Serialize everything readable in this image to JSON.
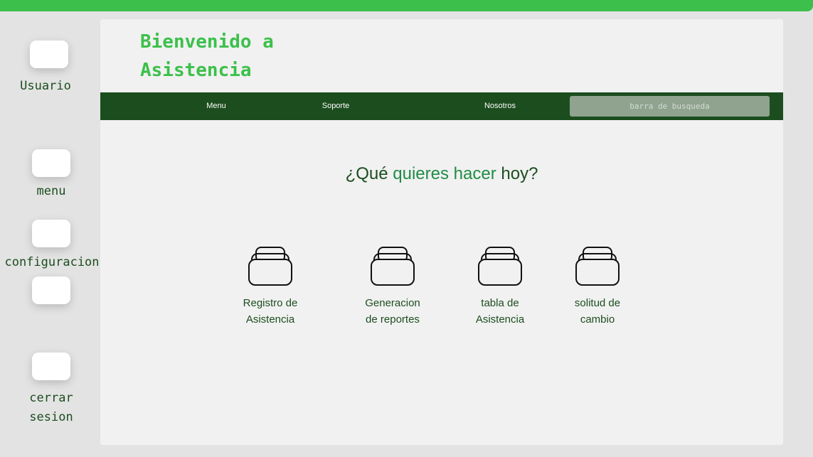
{
  "header": {
    "welcome_line1": "Bienvenido a",
    "welcome_line2": "Asistencia"
  },
  "sidebar": {
    "items": [
      {
        "label_lines": [
          "Usuario"
        ]
      },
      {
        "label_lines": [
          "menu"
        ]
      },
      {
        "label_lines": [
          "configuracion"
        ]
      },
      {
        "label_lines": []
      },
      {
        "label_lines": [
          "cerrar",
          "sesion"
        ]
      }
    ]
  },
  "nav": {
    "items": [
      {
        "label": "Menu"
      },
      {
        "label": "Soporte"
      },
      {
        "label": "Nosotros"
      }
    ],
    "search_placeholder": "barra de busqueda"
  },
  "main": {
    "question_prefix": "¿Qué ",
    "question_accent": "quieres hacer",
    "question_suffix": " hoy?",
    "tiles": [
      {
        "line1": "Registro de",
        "line2": "Asistencia",
        "icon": "stack-icon"
      },
      {
        "line1": "Generacion",
        "line2": "de reportes",
        "icon": "stack-icon"
      },
      {
        "line1": "tabla de",
        "line2": "Asistencia",
        "icon": "stack-icon"
      },
      {
        "line1": "solitud de",
        "line2": "cambio",
        "icon": "stack-icon"
      }
    ]
  },
  "colors": {
    "brand_green": "#3cc04b",
    "dark_green": "#1c4d1f",
    "accent_green": "#1f8c46"
  }
}
